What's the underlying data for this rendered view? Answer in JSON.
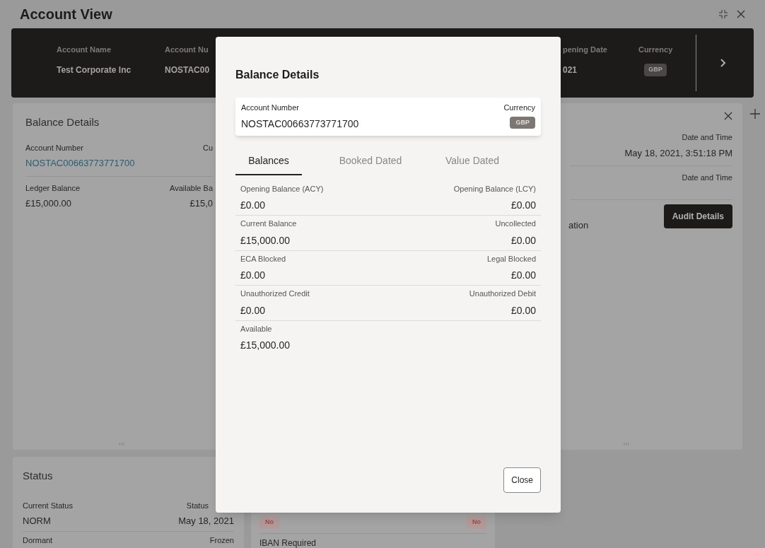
{
  "window": {
    "title": "Account View"
  },
  "header_bar": {
    "fields": [
      {
        "label": "Account Name",
        "value": "Test Corporate Inc",
        "kind": "text"
      },
      {
        "label": "Account Nu",
        "value": "NOSTAC00",
        "kind": "text"
      },
      {
        "label": "pening Date",
        "value": "021",
        "kind": "text"
      },
      {
        "label": "Currency",
        "value": "GBP",
        "kind": "badge"
      }
    ]
  },
  "balance_card": {
    "title": "Balance Details",
    "account_label": "Account Number",
    "account_value": "NOSTAC00663773771700",
    "currency_label": "Cu",
    "ledger_label": "Ledger Balance",
    "ledger_value": "£15,000.00",
    "available_label": "Available Ba",
    "available_value": "£15,0"
  },
  "audit_card": {
    "rows": [
      {
        "label": "Date and Time",
        "value": "May 18, 2021, 3:51:18 PM"
      },
      {
        "label": "Date and Time"
      }
    ],
    "partial_text": "ation",
    "button": "Audit Details"
  },
  "status_card": {
    "title": "Status",
    "rows": [
      {
        "left_label": "Current Status",
        "left_value": "NORM",
        "right_label": "Status",
        "right_value": "May 18, 2021"
      },
      {
        "left_label": "Dormant",
        "right_label": "Frozen"
      }
    ]
  },
  "flags_card": {
    "badges": [
      "No",
      "No"
    ],
    "label": "IBAN Required"
  },
  "dialog": {
    "title": "Balance Details",
    "account_label": "Account Number",
    "account_value": "NOSTAC00663773771700",
    "currency_label": "Currency",
    "currency_value": "GBP",
    "tabs": [
      {
        "label": "Balances",
        "selected": true
      },
      {
        "label": "Booked Dated",
        "selected": false
      },
      {
        "label": "Value Dated",
        "selected": false
      }
    ],
    "rows": [
      {
        "left_label": "Opening Balance (ACY)",
        "left_value": "£0.00",
        "right_label": "Opening Balance (LCY)",
        "right_value": "£0.00"
      },
      {
        "left_label": "Current Balance",
        "left_value": "£15,000.00",
        "right_label": "Uncollected",
        "right_value": "£0.00"
      },
      {
        "left_label": "ECA Blocked",
        "left_value": "£0.00",
        "right_label": "Legal Blocked",
        "right_value": "£0.00"
      },
      {
        "left_label": "Unauthorized Credit",
        "left_value": "£0.00",
        "right_label": "Unauthorized Debit",
        "right_value": "£0.00"
      },
      {
        "left_label": "Available",
        "left_value": "£15,000.00"
      }
    ],
    "close": "Close"
  }
}
